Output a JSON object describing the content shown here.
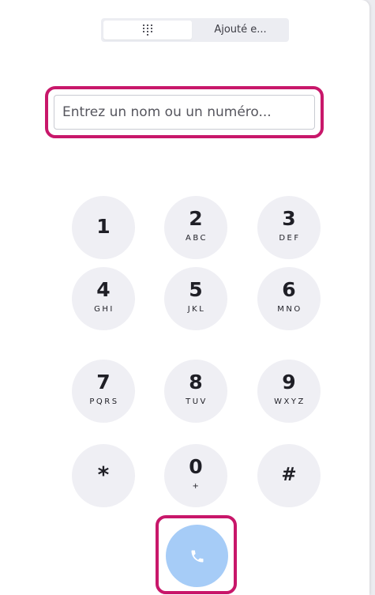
{
  "toggle": {
    "keypad_icon": "dialpad-grid-icon",
    "added_label": "Ajouté e..."
  },
  "search": {
    "placeholder": "Entrez un nom ou un numéro..."
  },
  "keypad": {
    "keys": [
      {
        "digit": "1",
        "letters": ""
      },
      {
        "digit": "2",
        "letters": "ABC"
      },
      {
        "digit": "3",
        "letters": "DEF"
      },
      {
        "digit": "4",
        "letters": "GHI"
      },
      {
        "digit": "5",
        "letters": "JKL"
      },
      {
        "digit": "6",
        "letters": "MNO"
      },
      {
        "digit": "7",
        "letters": "PQRS"
      },
      {
        "digit": "8",
        "letters": "TUV"
      },
      {
        "digit": "9",
        "letters": "WXYZ"
      },
      {
        "digit": "*",
        "letters": ""
      },
      {
        "digit": "0",
        "letters": "+"
      },
      {
        "digit": "#",
        "letters": ""
      }
    ]
  },
  "call": {
    "icon": "phone-icon"
  },
  "colors": {
    "highlight": "#c8176a",
    "key_bg": "#efeff4",
    "call_bg": "#a6ccf7"
  }
}
